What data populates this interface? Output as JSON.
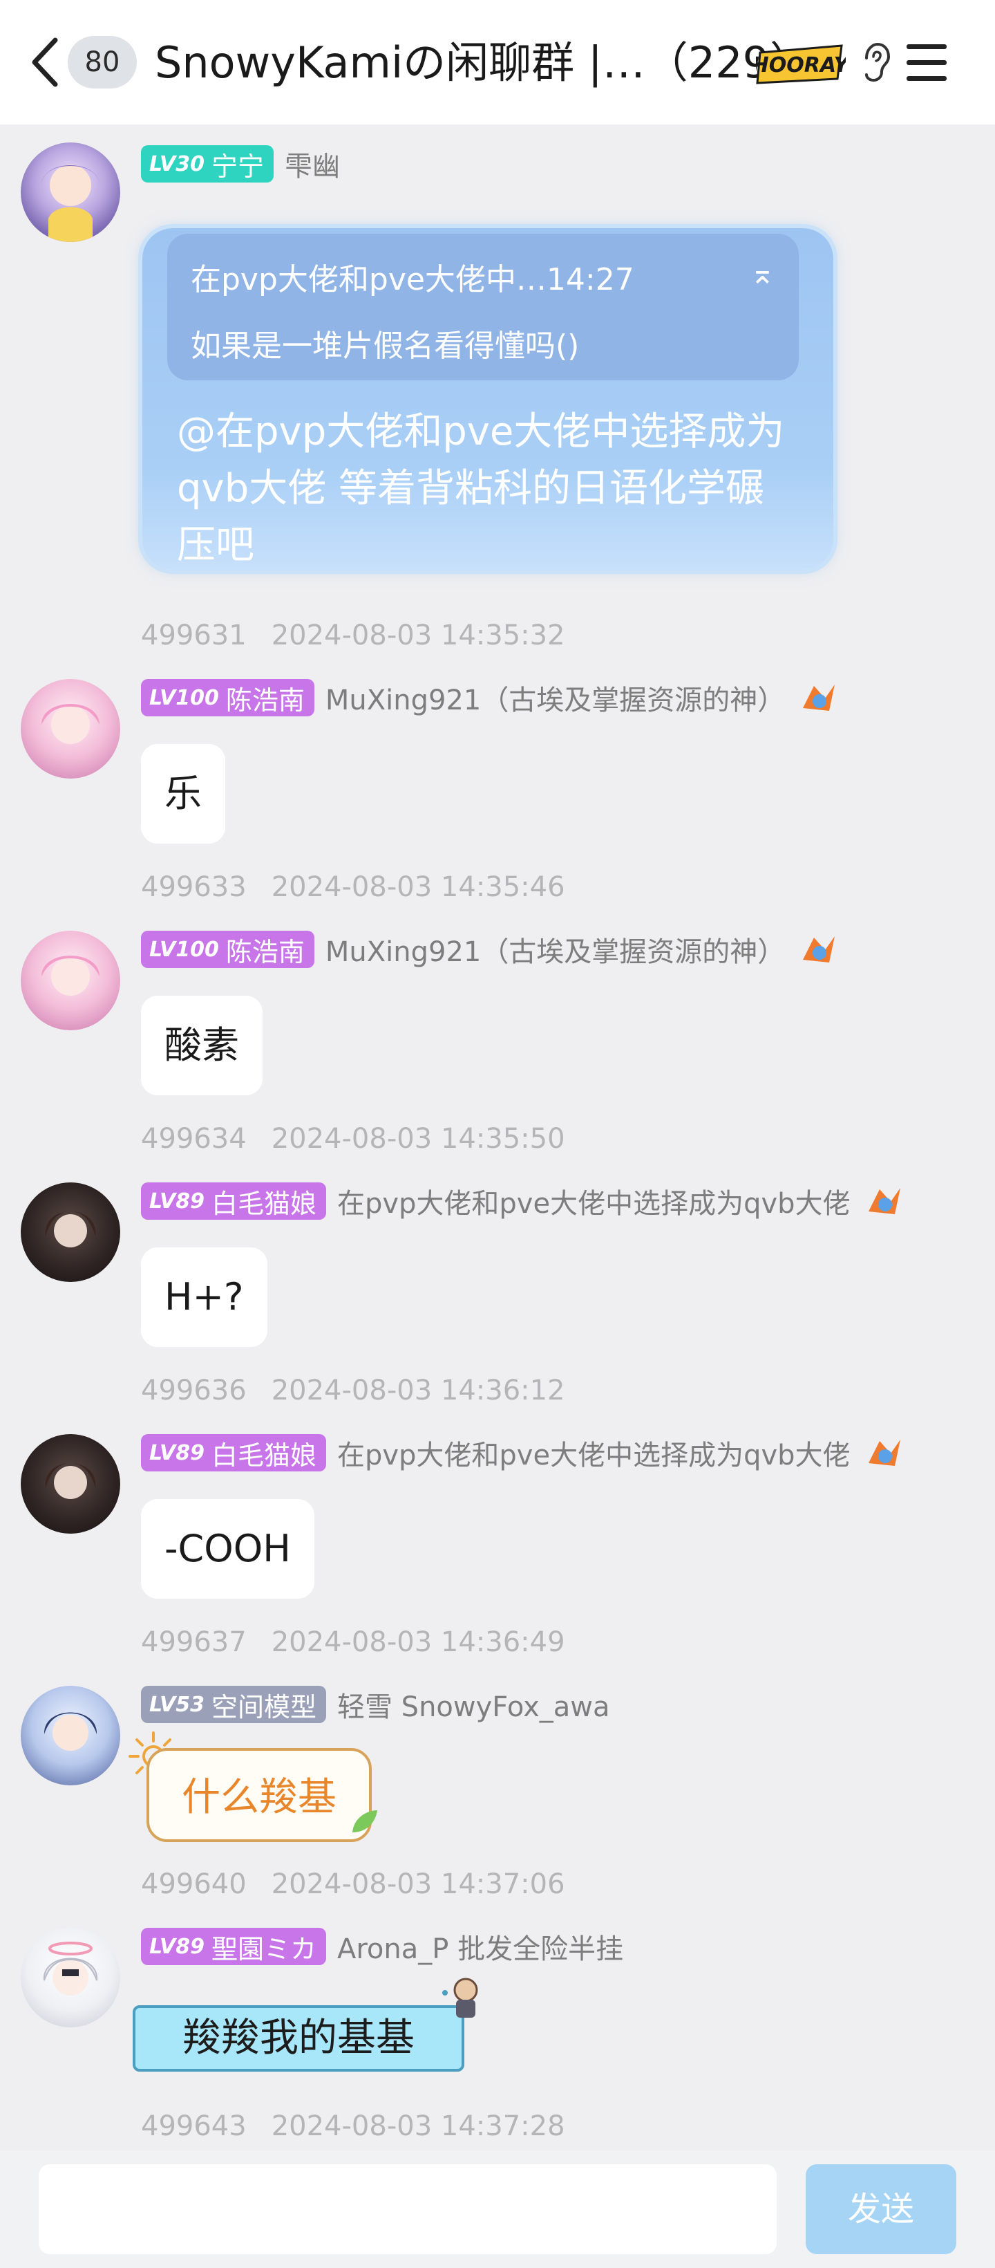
{
  "header": {
    "unread_count": "80",
    "title": "SnowyKamiの闲聊群 |…（229）",
    "badge_text": "HOORAY"
  },
  "messages": [
    {
      "level": "LV30",
      "title": "宁宁",
      "nickname": "雫幽",
      "badge_color": "#2fd4c0",
      "quote": {
        "line1": "在pvp大佬和pve大佬中…14:27",
        "line2": "如果是一堆片假名看得懂吗()"
      },
      "text": "@在pvp大佬和pve大佬中选择成为qvb大佬 等着背粘科的日语化学碾压吧",
      "msg_id": "499631",
      "time": "2024-08-03 14:35:32"
    },
    {
      "level": "LV100",
      "title": "陈浩南",
      "nickname": "MuXing921（古埃及掌握资源的神）",
      "badge_color": "#c775e8",
      "text": "乐",
      "msg_id": "499633",
      "time": "2024-08-03 14:35:46"
    },
    {
      "level": "LV100",
      "title": "陈浩南",
      "nickname": "MuXing921（古埃及掌握资源的神）",
      "badge_color": "#c775e8",
      "text": "酸素",
      "msg_id": "499634",
      "time": "2024-08-03 14:35:50"
    },
    {
      "level": "LV89",
      "title": "白毛猫娘",
      "nickname": "在pvp大佬和pve大佬中选择成为qvb大佬",
      "badge_color": "#c775e8",
      "text": "H+?",
      "msg_id": "499636",
      "time": "2024-08-03 14:36:12"
    },
    {
      "level": "LV89",
      "title": "白毛猫娘",
      "nickname": "在pvp大佬和pve大佬中选择成为qvb大佬",
      "badge_color": "#c775e8",
      "text": "-COOH",
      "msg_id": "499637",
      "time": "2024-08-03 14:36:49"
    },
    {
      "level": "LV53",
      "title": "空间模型",
      "nickname": "轻雪 SnowyFox_awa",
      "badge_color": "#9aa0b8",
      "text": "什么羧基",
      "msg_id": "499640",
      "time": "2024-08-03 14:37:06"
    },
    {
      "level": "LV89",
      "title": "聖園ミカ",
      "nickname": "Arona_P 批发全险半挂",
      "badge_color": "#c775e8",
      "text": "羧羧我的基基",
      "msg_id": "499643",
      "time": "2024-08-03 14:37:28"
    }
  ],
  "footer": {
    "input_value": "",
    "send_label": "发送"
  }
}
